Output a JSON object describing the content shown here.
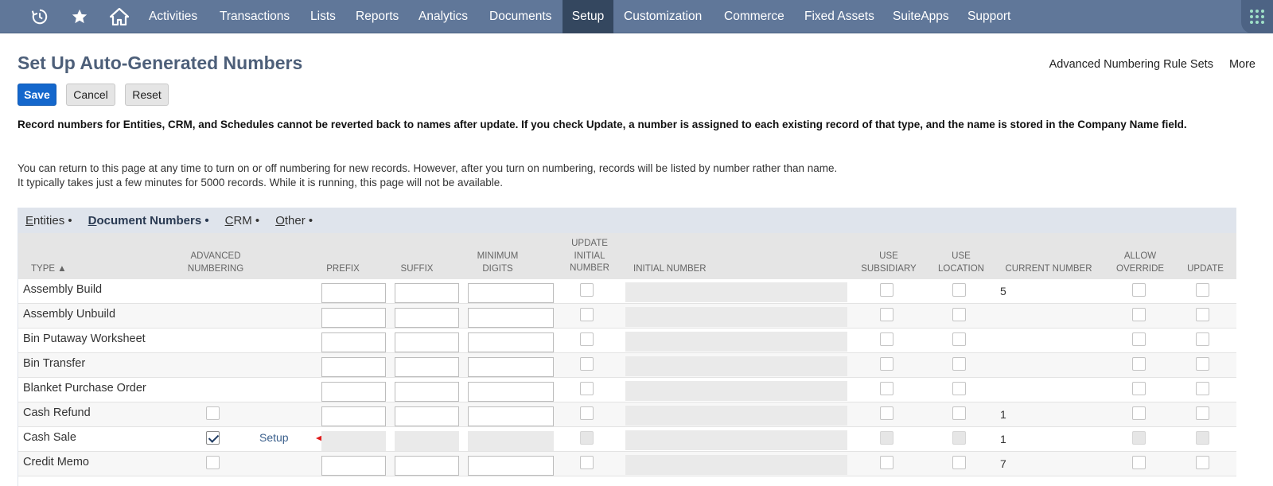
{
  "nav": {
    "icons": [
      "recent-records-icon",
      "star-icon",
      "home-icon"
    ],
    "items": [
      "Activities",
      "Transactions",
      "Lists",
      "Reports",
      "Analytics",
      "Documents",
      "Setup",
      "Customization",
      "Commerce",
      "Fixed Assets",
      "SuiteApps",
      "Support"
    ],
    "active": "Setup",
    "bar_color": "#607799",
    "active_color": "#34475f"
  },
  "page": {
    "title": "Set Up Auto-Generated Numbers",
    "links": [
      "Advanced Numbering Rule Sets",
      "More"
    ]
  },
  "buttons": {
    "save": "Save",
    "cancel": "Cancel",
    "reset": "Reset"
  },
  "notice": {
    "bold": "Record numbers for Entities, CRM, and Schedules cannot be reverted back to names after update. If you check Update, a number is assigned to each existing record of that type, and the name is stored in the Company Name field.",
    "line1": "You can return to this page at any time to turn on or off numbering for new records. However, after you turn on numbering, records will be listed by number rather than name.",
    "line2": "It typically takes just a few minutes for 5000 records. While it is running, this page will not be available."
  },
  "tabs": [
    {
      "first": "E",
      "rest": "ntities",
      "dot": " •"
    },
    {
      "first": "D",
      "rest": "ocument Numbers",
      "dot": " •",
      "active": true
    },
    {
      "first": "C",
      "rest": "RM",
      "dot": " •"
    },
    {
      "first": "O",
      "rest": "ther",
      "dot": " •"
    }
  ],
  "columns": {
    "type": "TYPE ▲",
    "advanced": "ADVANCED NUMBERING",
    "prefix": "PREFIX",
    "suffix": "SUFFIX",
    "min_digits": "MINIMUM DIGITS",
    "update_initial": "UPDATE INITIAL NUMBER",
    "initial_number": "INITIAL NUMBER",
    "use_subsidiary": "USE SUBSIDIARY",
    "use_location": "USE LOCATION",
    "current_number": "CURRENT NUMBER",
    "allow_override": "ALLOW OVERRIDE",
    "update": "UPDATE"
  },
  "rows": [
    {
      "type": "Assembly Build",
      "adv": "none",
      "current": "5"
    },
    {
      "type": "Assembly Unbuild",
      "adv": "none",
      "current": ""
    },
    {
      "type": "Bin Putaway Worksheet",
      "adv": "none",
      "current": ""
    },
    {
      "type": "Bin Transfer",
      "adv": "none",
      "current": ""
    },
    {
      "type": "Blanket Purchase Order",
      "adv": "none",
      "current": ""
    },
    {
      "type": "Cash Refund",
      "adv": "unchecked",
      "current": "1"
    },
    {
      "type": "Cash Sale",
      "adv": "checked",
      "current": "1",
      "setup_link": "Setup",
      "disabled": true
    },
    {
      "type": "Credit Memo",
      "adv": "unchecked",
      "current": "7"
    }
  ]
}
